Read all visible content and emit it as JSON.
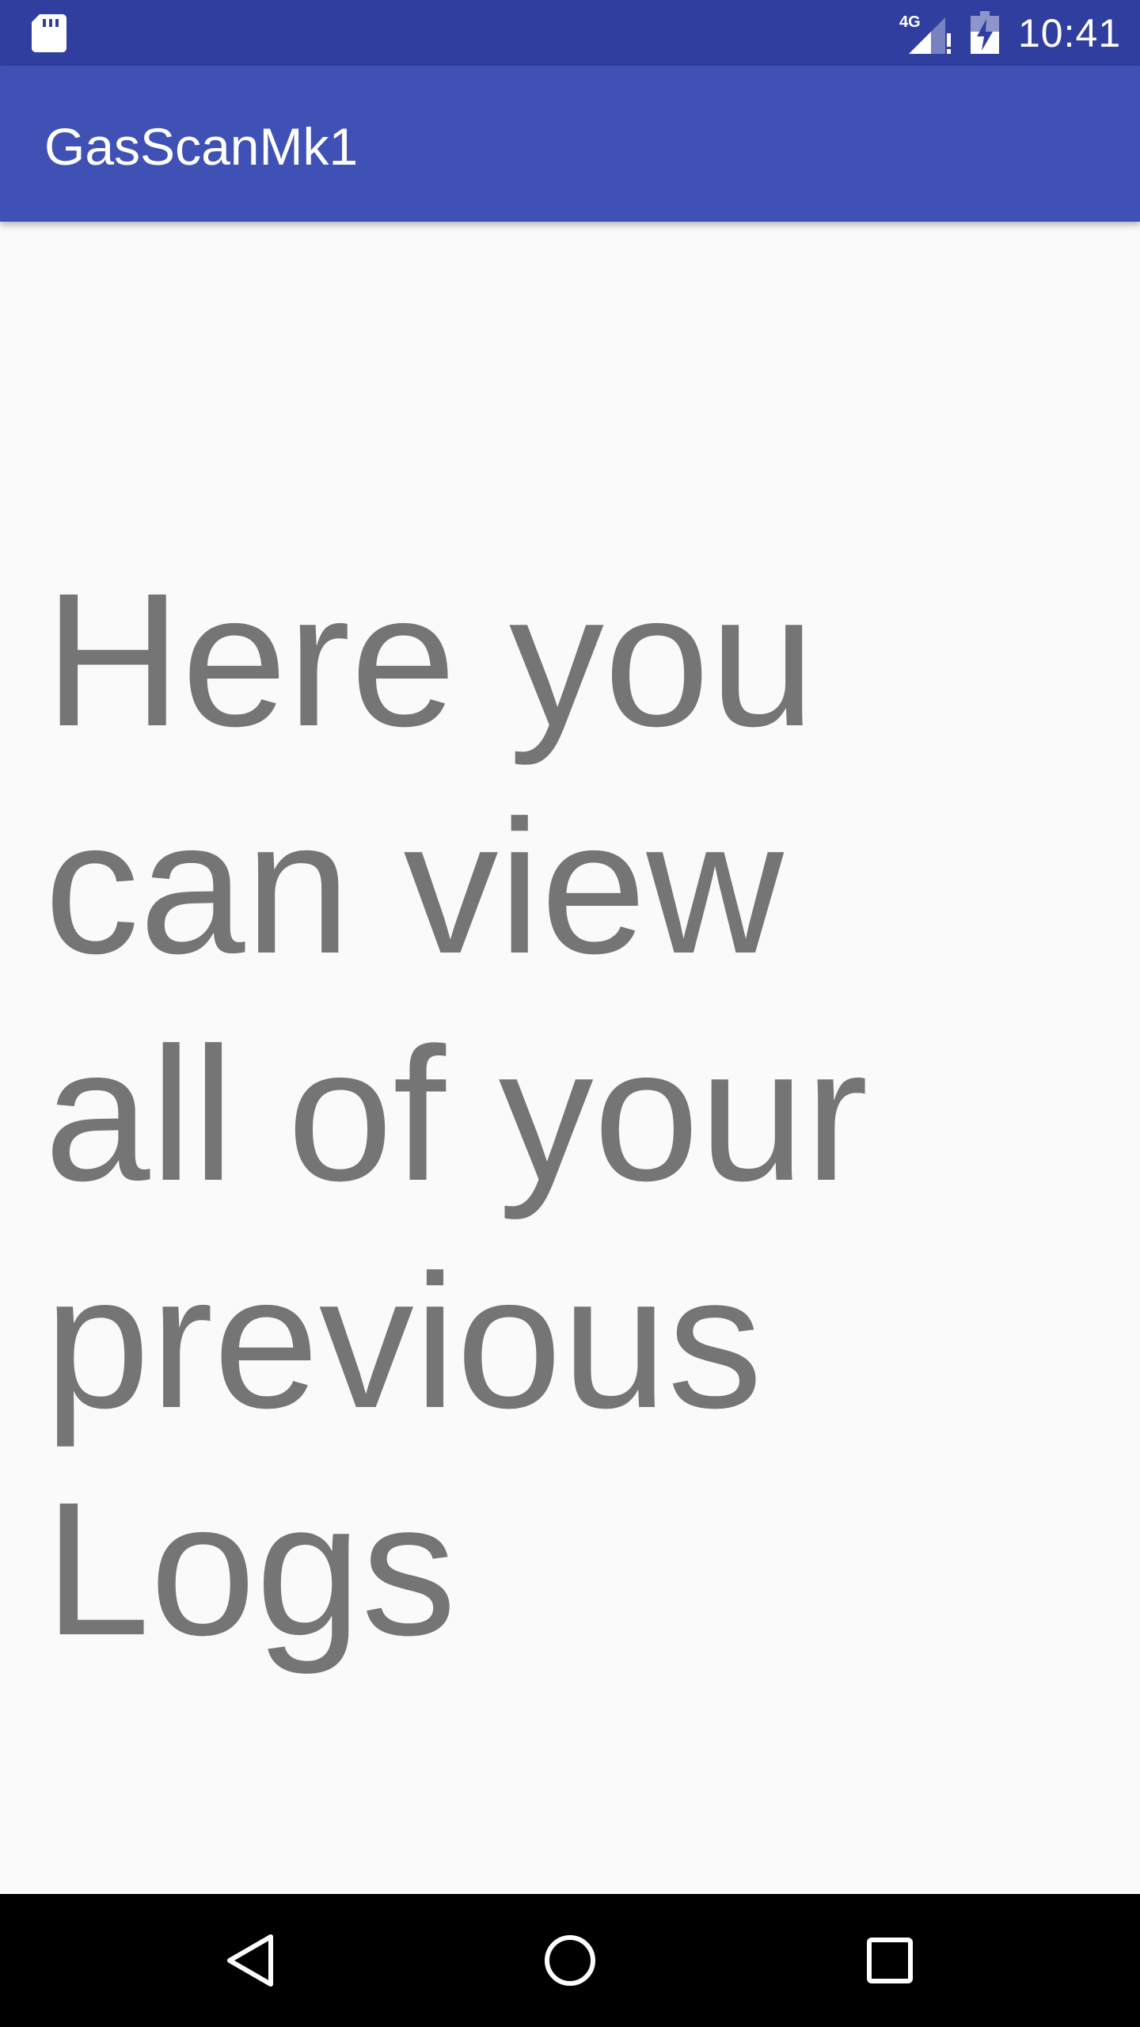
{
  "status_bar": {
    "time": "10:41",
    "network_label": "4G",
    "icons": [
      "sd-card-icon",
      "signal-4g-icon",
      "battery-charging-icon"
    ]
  },
  "app_bar": {
    "title": "GasScanMk1",
    "background_color": "#3f51b5",
    "status_bar_color": "#303f9f"
  },
  "content": {
    "message": "Here you can view all of your previous Logs",
    "text_color": "#757575"
  },
  "nav_bar": {
    "icons": [
      "back-icon",
      "home-icon",
      "recents-icon"
    ]
  }
}
